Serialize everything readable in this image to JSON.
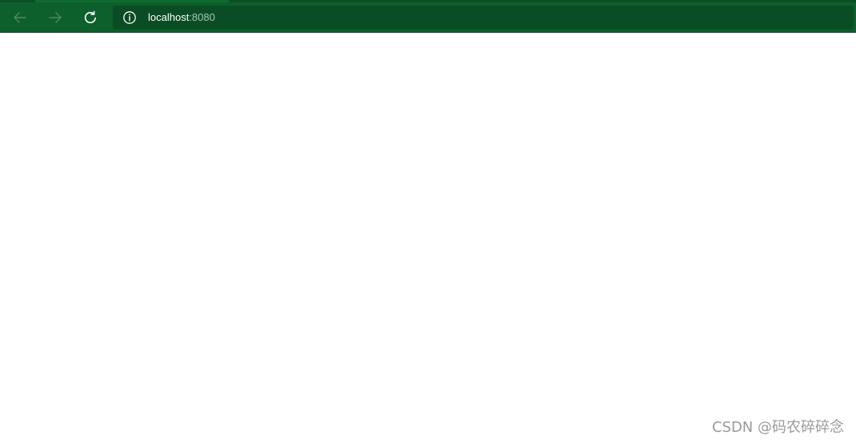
{
  "browser": {
    "address_bar": {
      "host": "localhost",
      "port": ":8080"
    },
    "icons": {
      "back": "arrow-left-icon",
      "forward": "arrow-right-icon",
      "reload": "reload-icon",
      "site_info": "info-icon"
    },
    "colors": {
      "toolbar": "#0d5f2b",
      "address_bar": "#0a4d24"
    }
  },
  "page": {
    "watermark": "CSDN @码农碎碎念"
  }
}
